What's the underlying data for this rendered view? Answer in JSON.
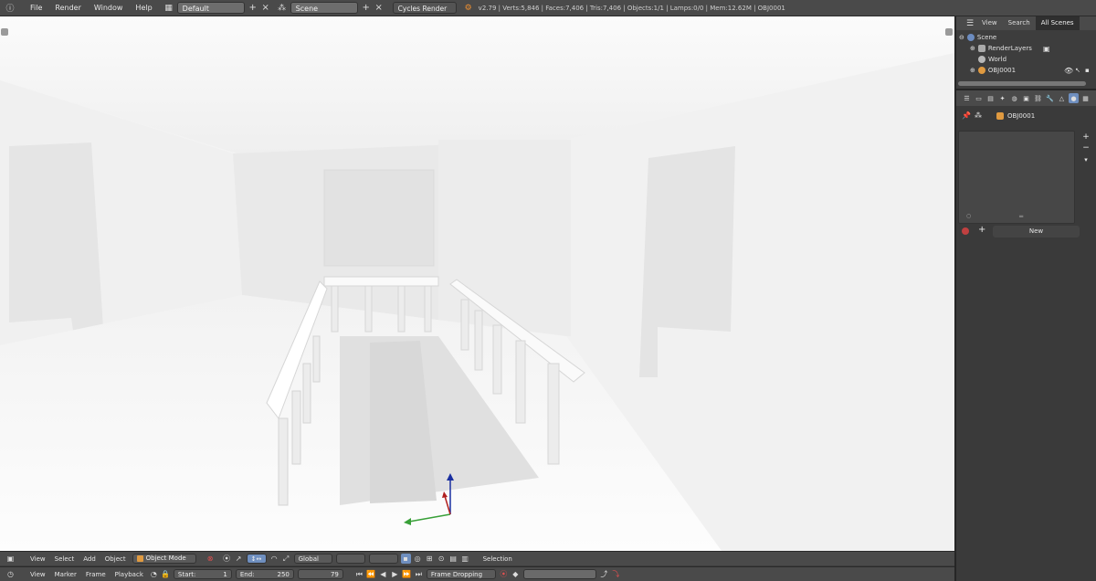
{
  "top_bar": {
    "info_icon": "info-icon",
    "menus": [
      "File",
      "Render",
      "Window",
      "Help"
    ],
    "screen_layout": "Default",
    "scene": "Scene",
    "render_engine": "Cycles Render",
    "stats": "v2.79 | Verts:5,846 | Faces:7,406 | Tris:7,406 | Objects:1/1 | Lamps:0/0 | Mem:12.62M | OBJ0001"
  },
  "outliner": {
    "tabs": [
      "View",
      "Search",
      "All Scenes"
    ],
    "active_tab": "All Scenes",
    "tree": [
      {
        "label": "Scene",
        "indent": 0
      },
      {
        "label": "RenderLayers",
        "indent": 1
      },
      {
        "label": "World",
        "indent": 1
      },
      {
        "label": "OBJ0001",
        "indent": 1
      }
    ]
  },
  "properties": {
    "context_object": "OBJ0001",
    "new_label": "New",
    "add_label": "+",
    "remove_label": "−"
  },
  "view3d_header": {
    "menus": [
      "View",
      "Select",
      "Add",
      "Object"
    ],
    "mode": "Object Mode",
    "orientation": "Global",
    "selection_label": "Selection"
  },
  "timeline_header": {
    "menus": [
      "View",
      "Marker",
      "Frame",
      "Playback"
    ],
    "start_label": "Start:",
    "start_value": "1",
    "end_label": "End:",
    "end_value": "250",
    "current_frame": "79",
    "sync_mode": "Frame Dropping"
  },
  "colors": {
    "header_bg": "#4a4a4a",
    "panel_bg": "#3d3d3d",
    "viewport_bg": "#f3f3f3",
    "active_blue": "#6f8fbf",
    "axis_x": "#38a038",
    "axis_y": "#1a2fa0",
    "axis_z": "#b02020"
  }
}
